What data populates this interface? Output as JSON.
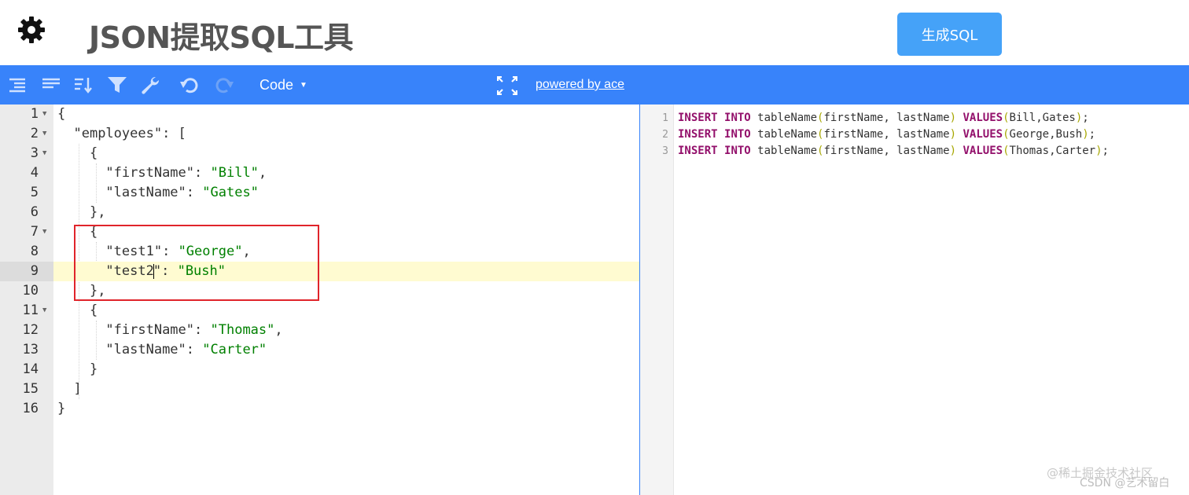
{
  "header": {
    "title": "JSON提取SQL工具",
    "generate_button": "生成SQL"
  },
  "toolbar": {
    "icons": [
      "format-icon",
      "compact-icon",
      "sort-icon",
      "filter-icon",
      "repair-icon",
      "undo-icon",
      "redo-icon",
      "fullscreen-icon"
    ],
    "mode_label": "Code",
    "powered_by": "powered by ace"
  },
  "json_editor": {
    "active_line": 9,
    "lines": [
      {
        "num": "1",
        "fold": true
      },
      {
        "num": "2",
        "fold": true
      },
      {
        "num": "3",
        "fold": true
      },
      {
        "num": "4",
        "fold": false
      },
      {
        "num": "5",
        "fold": false
      },
      {
        "num": "6",
        "fold": false
      },
      {
        "num": "7",
        "fold": true
      },
      {
        "num": "8",
        "fold": false
      },
      {
        "num": "9",
        "fold": false
      },
      {
        "num": "10",
        "fold": false
      },
      {
        "num": "11",
        "fold": true
      },
      {
        "num": "12",
        "fold": false
      },
      {
        "num": "13",
        "fold": false
      },
      {
        "num": "14",
        "fold": false
      },
      {
        "num": "15",
        "fold": false
      },
      {
        "num": "16",
        "fold": false
      }
    ],
    "tokens": {
      "l1": "{",
      "l2_key": "\"employees\"",
      "l2_rest": ": [",
      "l3": "{",
      "l4_key": "\"firstName\"",
      "l4_val": "\"Bill\"",
      "l5_key": "\"lastName\"",
      "l5_val": "\"Gates\"",
      "l6": "},",
      "l7": "{",
      "l8_key": "\"test1\"",
      "l8_val": "\"George\"",
      "l9_key_a": "\"test2",
      "l9_key_b": "\"",
      "l9_val": "\"Bush\"",
      "l10": "},",
      "l11": "{",
      "l12_key": "\"firstName\"",
      "l12_val": "\"Thomas\"",
      "l13_key": "\"lastName\"",
      "l13_val": "\"Carter\"",
      "l14": "}",
      "l15": "]",
      "l16": "}",
      "colon": ": ",
      "comma": ","
    }
  },
  "sql_output": {
    "lines": [
      {
        "num": "1",
        "kw1": "INSERT",
        "kw2": "INTO",
        "table": "tableName",
        "cols": "firstName, lastName",
        "kw3": "VALUES",
        "vals": "Bill,Gates"
      },
      {
        "num": "2",
        "kw1": "INSERT",
        "kw2": "INTO",
        "table": "tableName",
        "cols": "firstName, lastName",
        "kw3": "VALUES",
        "vals": "George,Bush"
      },
      {
        "num": "3",
        "kw1": "INSERT",
        "kw2": "INTO",
        "table": "tableName",
        "cols": "firstName, lastName",
        "kw3": "VALUES",
        "vals": "Thomas,Carter"
      }
    ]
  },
  "watermark": {
    "line1": "@稀土掘金技术社区",
    "line2": "CSDN @艺术留白"
  },
  "colors": {
    "toolbar": "#3883fa",
    "button": "#45a2f8",
    "string": "#008000",
    "sql_keyword": "#93106b",
    "highlight_box": "#e0242a"
  }
}
